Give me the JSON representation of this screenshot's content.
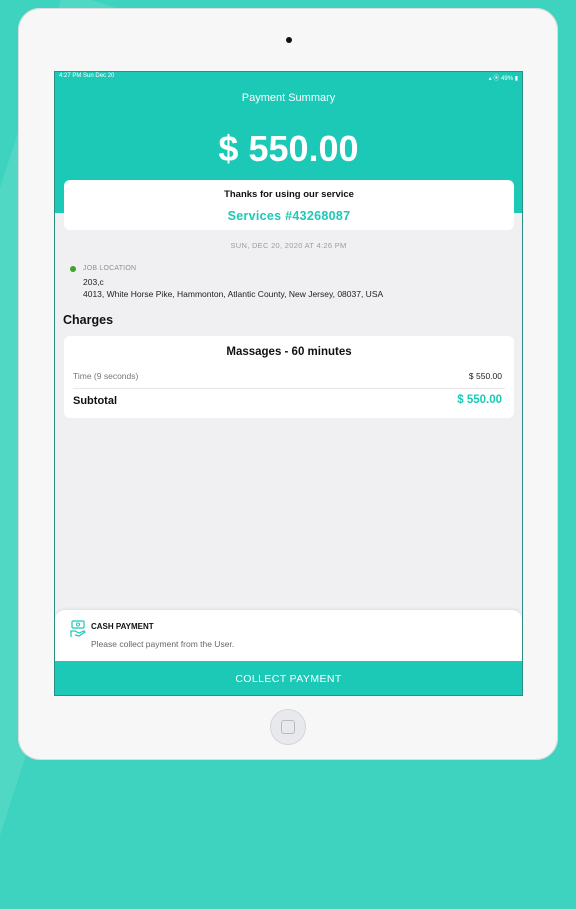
{
  "status_bar": {
    "time": "4:27 PM   Sun Dec 20",
    "indicators": "▴ ⦿ 49% ▮"
  },
  "header": {
    "title": "Payment Summary",
    "amount": "$ 550.00"
  },
  "thanks_card": {
    "message": "Thanks for using our service",
    "service_id": "Services #43268087"
  },
  "date": "SUN, DEC 20, 2020 AT 4:26 PM",
  "job_location": {
    "label": "JOB LOCATION",
    "line1": "203,c",
    "line2": "4013, White Horse Pike, Hammonton, Atlantic County, New Jersey, 08037, USA"
  },
  "charges": {
    "heading": "Charges",
    "title": "Massages - 60 minutes",
    "row_label": "Time (9 seconds)",
    "row_value": "$ 550.00",
    "subtotal_label": "Subtotal",
    "subtotal_value": "$ 550.00"
  },
  "payment": {
    "title": "CASH PAYMENT",
    "description": "Please collect payment from the User.",
    "icon": "cash-icon"
  },
  "collect_button": "COLLECT PAYMENT",
  "colors": {
    "accent": "#1bc9b6",
    "background": "#3ed3bf",
    "location_dot": "#3fa32e"
  }
}
